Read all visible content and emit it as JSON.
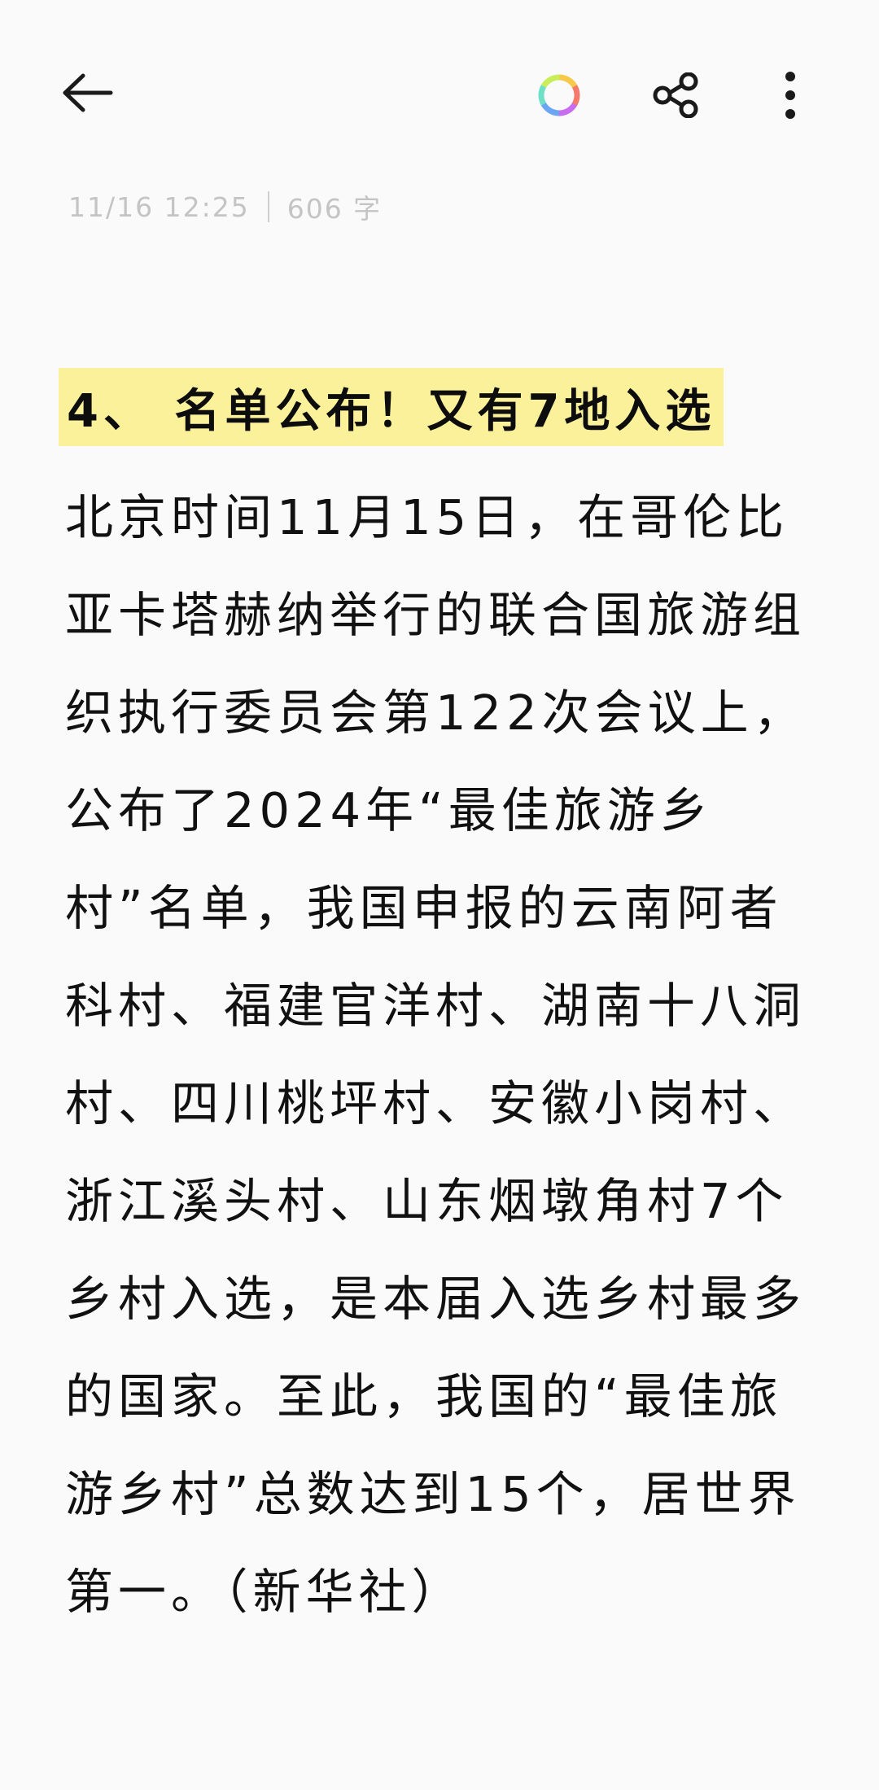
{
  "toolbar": {
    "back_icon": "arrow-left-icon",
    "theme_icon": "color-ring-icon",
    "share_icon": "share-icon",
    "more_icon": "more-vertical-icon",
    "ring_colors": [
      "#f7c94b",
      "#f47a6b",
      "#c86cf0",
      "#6aa7f2",
      "#6fe0c8",
      "#c8ee5a"
    ]
  },
  "meta": {
    "datetime": "11/16 12:25",
    "word_count": "606 字"
  },
  "note": {
    "title": "4、 名单公布！又有7地入选",
    "highlight_color": "#fbf19a",
    "body": "北京时间11月15日，在哥伦比亚卡塔赫纳举行的联合国旅游组织执行委员会第122次会议上，公布了2024年“最佳旅游乡村”名单，我国申报的云南阿者科村、福建官洋村、湖南十八洞村、四川桃坪村、安徽小岗村、浙江溪头村、山东烟墩角村7个乡村入选，是本届入选乡村最多的国家。至此，我国的“最佳旅游乡村”总数达到15个，居世界第一。（新华社）"
  }
}
